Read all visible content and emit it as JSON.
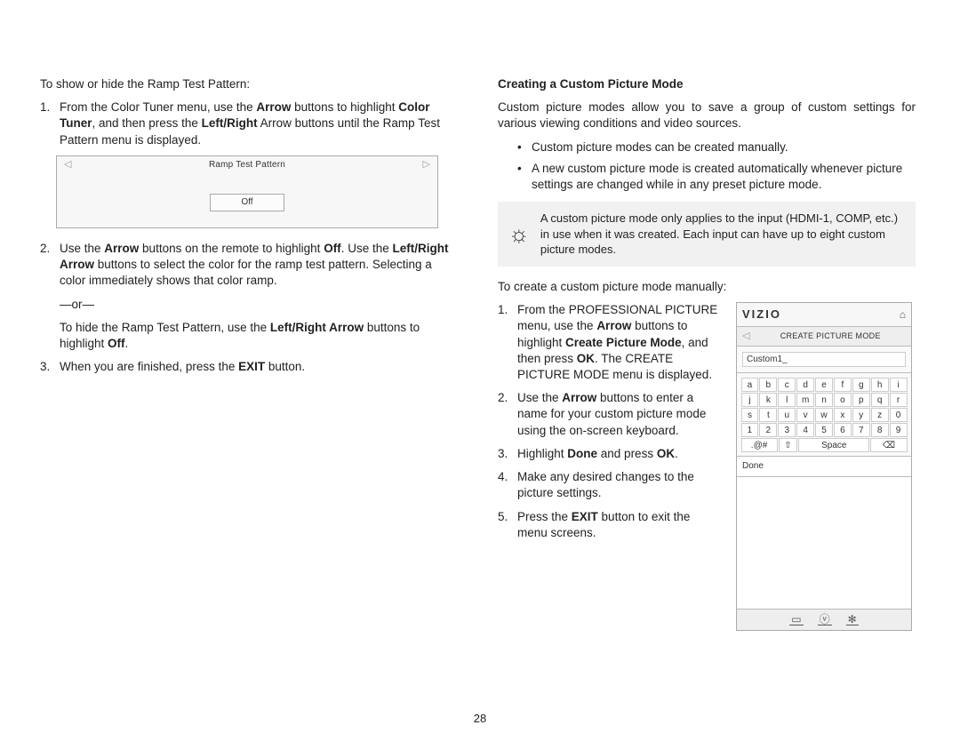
{
  "left": {
    "intro": "To show or hide the Ramp Test Pattern:",
    "step1_a": "From the Color Tuner menu, use the ",
    "step1_b": "Arrow",
    "step1_c": " buttons to highlight ",
    "step1_d": "Color Tuner",
    "step1_e": ", and then press the ",
    "step1_f": "Left/Right",
    "step1_g": " Arrow buttons until the Ramp Test Pattern menu is displayed.",
    "ramp_title": "Ramp Test Pattern",
    "ramp_off": "Off",
    "step2_a": "Use the ",
    "step2_b": "Arrow",
    "step2_c": " buttons on the remote to highlight ",
    "step2_d": "Off",
    "step2_e": ". Use the ",
    "step2_f": "Left/Right Arrow",
    "step2_g": " buttons to select the color for the ramp test pattern. Selecting a color immediately shows that color ramp.",
    "or": "—or—",
    "hide_a": "To hide the Ramp Test Pattern, use the ",
    "hide_b": "Left/Right Arrow",
    "hide_c": " buttons to highlight ",
    "hide_d": "Off",
    "hide_e": ".",
    "step3_a": "When you are finished, press the ",
    "step3_b": "EXIT",
    "step3_c": " button."
  },
  "right": {
    "heading": "Creating a Custom Picture Mode",
    "intro": "Custom picture modes allow you to save a group of custom settings for various viewing conditions and video sources.",
    "b1": "Custom picture modes can be created manually.",
    "b2": "A new custom picture mode is created automatically whenever picture settings are changed while in any preset picture mode.",
    "tip": "A custom picture mode only applies to the input (HDMI-1, COMP, etc.) in use when it was created. Each input can have up to eight custom picture modes.",
    "lead": "To create a custom picture mode manually:",
    "s1_a": "From the PROFESSIONAL PICTURE menu, use the ",
    "s1_b": "Arrow",
    "s1_c": " buttons to highlight ",
    "s1_d": "Create Picture Mode",
    "s1_e": ", and then press ",
    "s1_f": "OK",
    "s1_g": ". The CREATE PICTURE MODE menu is displayed.",
    "s2_a": "Use the ",
    "s2_b": "Arrow",
    "s2_c": " buttons to enter a name for your custom picture mode using the on-screen keyboard.",
    "s3_a": "Highlight ",
    "s3_b": "Done",
    "s3_c": " and press ",
    "s3_d": "OK",
    "s3_e": ".",
    "s4": "Make any desired changes to the picture settings.",
    "s5_a": "Press the ",
    "s5_b": "EXIT",
    "s5_c": " button to exit the menu screens."
  },
  "vizio": {
    "logo": "VIZIO",
    "crumb": "CREATE PICTURE MODE",
    "input_value": "Custom1_",
    "row1": [
      "a",
      "b",
      "c",
      "d",
      "e",
      "f",
      "g",
      "h",
      "i"
    ],
    "row2": [
      "j",
      "k",
      "l",
      "m",
      "n",
      "o",
      "p",
      "q",
      "r"
    ],
    "row3": [
      "s",
      "t",
      "u",
      "v",
      "w",
      "x",
      "y",
      "z",
      "0"
    ],
    "row4": [
      "1",
      "2",
      "3",
      "4",
      "5",
      "6",
      "7",
      "8",
      "9"
    ],
    "sym": ".@#",
    "shift": "⇧",
    "space": "Space",
    "bksp": "⌫",
    "done": "Done"
  },
  "page_number": "28"
}
